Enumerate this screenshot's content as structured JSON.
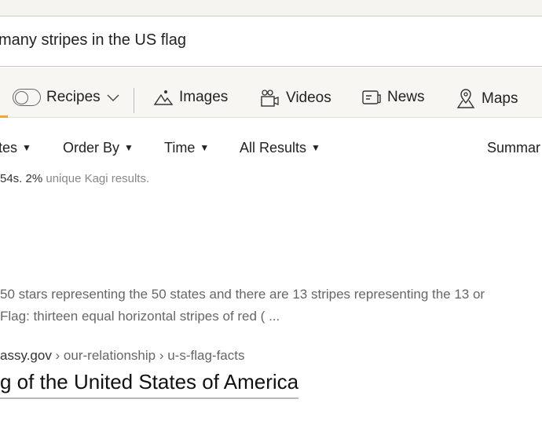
{
  "search": {
    "query": "many stripes in the US flag"
  },
  "nav": {
    "recipes": "Recipes",
    "images": "Images",
    "videos": "Videos",
    "news": "News",
    "maps": "Maps"
  },
  "filters": {
    "sites": "tes",
    "order": "Order By",
    "time": "Time",
    "results": "All Results",
    "summarize": "Summar"
  },
  "stats": {
    "time": "54s. 2%",
    "text": " unique Kagi results."
  },
  "result_snippet": {
    "line1": "50 stars representing the 50 states and there are 13 stripes representing the 13 or",
    "line2": "Flag: thirteen equal horizontal stripes of red ( ..."
  },
  "result": {
    "domain": "assy.gov",
    "path": " › our-relationship › u-s-flag-facts",
    "title": "g of the United States of America"
  },
  "colors": {
    "accent": "#f0a92a"
  }
}
